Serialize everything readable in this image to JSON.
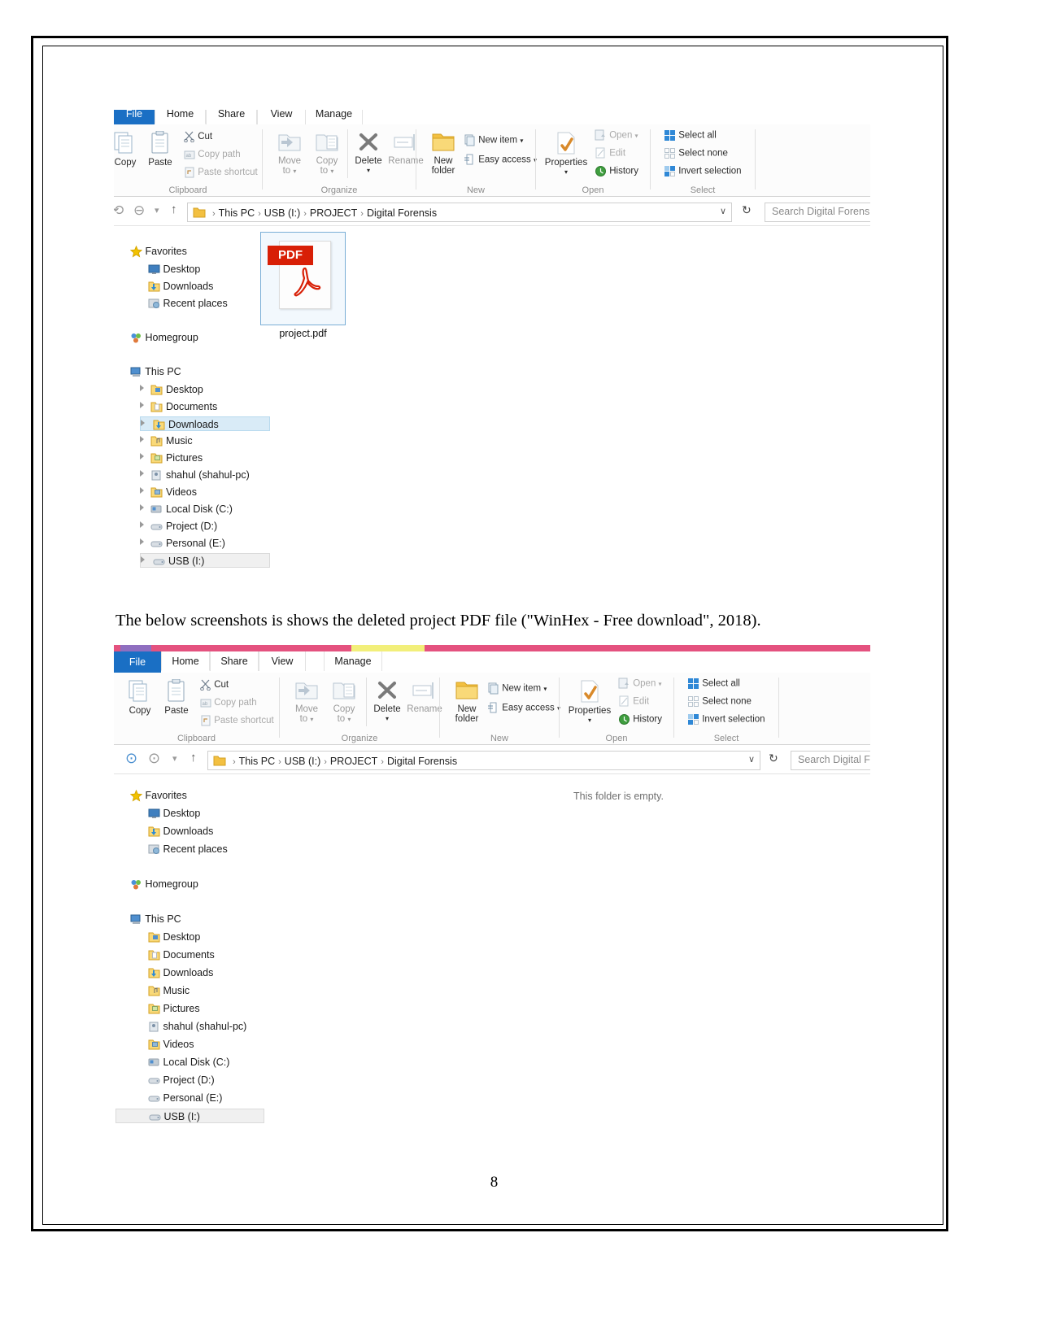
{
  "document": {
    "caption": "The below screenshots is shows the deleted project PDF file (\"WinHex - Free download\", 2018).",
    "page_number": "8"
  },
  "ribbon": {
    "tabs": [
      {
        "label": "File"
      },
      {
        "label": "Home"
      },
      {
        "label": "Share"
      },
      {
        "label": "View"
      },
      {
        "label": "Manage"
      }
    ],
    "groups": [
      {
        "label": "Clipboard"
      },
      {
        "label": "Organize"
      },
      {
        "label": "New"
      },
      {
        "label": "Open"
      },
      {
        "label": "Select"
      }
    ],
    "clipboard": {
      "copy": "Copy",
      "paste": "Paste",
      "cut": "Cut",
      "copy_path": "Copy path",
      "paste_shortcut": "Paste shortcut"
    },
    "organize": {
      "move_to_line1": "Move",
      "move_to_line2": "to",
      "copy_to_line1": "Copy",
      "copy_to_line2": "to",
      "delete": "Delete",
      "rename": "Rename"
    },
    "new": {
      "new_folder_line1": "New",
      "new_folder_line2": "folder",
      "new_item": "New item",
      "easy_access": "Easy access"
    },
    "open": {
      "properties": "Properties",
      "open": "Open",
      "edit": "Edit",
      "history": "History"
    },
    "select": {
      "select_all": "Select all",
      "select_none": "Select none",
      "invert_selection": "Invert selection"
    }
  },
  "address": {
    "crumbs": [
      "This PC",
      "USB (I:)",
      "PROJECT",
      "Digital Forensis"
    ],
    "separator": "›",
    "search_placeholder_top": "Search Digital Forensis",
    "search_placeholder_bottom": "Search Digital Fo",
    "refresh_icon": "refresh-icon",
    "dropdown_icon": "chevron-down-icon",
    "back_icon": "back-arrow-icon",
    "forward_icon": "forward-arrow-icon",
    "up_icon": "up-arrow-icon"
  },
  "navpane": {
    "favorites": {
      "label": "Favorites",
      "children": [
        "Desktop",
        "Downloads",
        "Recent places"
      ]
    },
    "homegroup": {
      "label": "Homegroup"
    },
    "this_pc": {
      "label": "This PC",
      "children": [
        "Desktop",
        "Documents",
        "Downloads",
        "Music",
        "Pictures",
        "shahul (shahul-pc)",
        "Videos",
        "Local Disk (C:)",
        "Project (D:)",
        "Personal (E:)",
        "USB (I:)"
      ]
    }
  },
  "screenshot_top": {
    "selected_tree_item": "Downloads",
    "highlighted_tree_item": "USB (I:)",
    "file": {
      "name": "project.pdf",
      "type_badge": "PDF"
    }
  },
  "screenshot_bottom": {
    "empty_message": "This folder is empty.",
    "selected_tree_item": "USB (I:)",
    "active_tab": "Home"
  },
  "colors": {
    "file_tab_blue": "#1a6fc4",
    "selection_blue": "#d9ebf7",
    "pdf_red": "#d81f06",
    "strip_pink": "#e4527f",
    "strip_yellow": "#f2ef7a"
  }
}
